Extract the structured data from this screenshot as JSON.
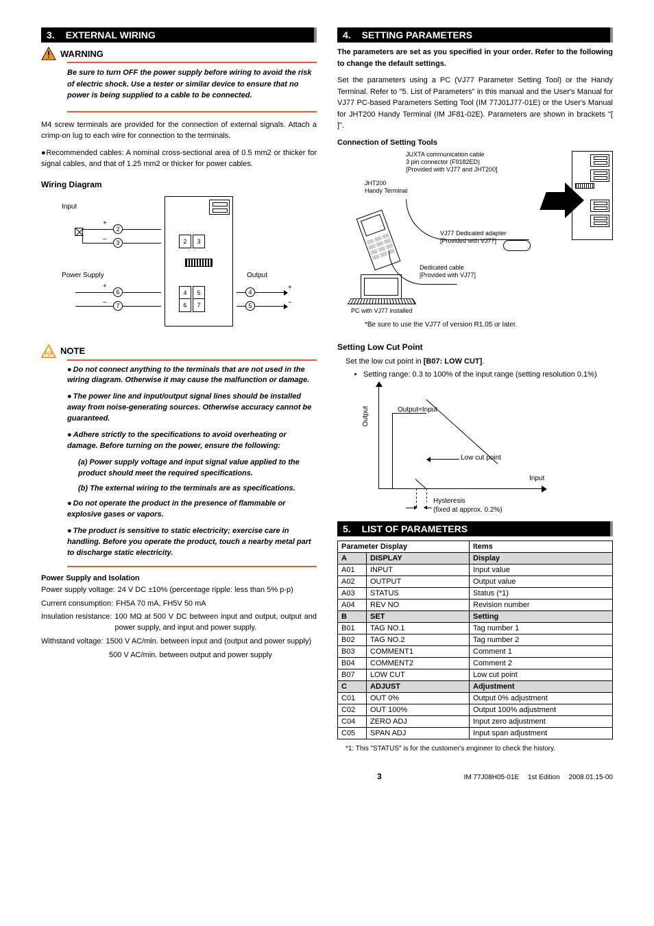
{
  "left": {
    "sec3": {
      "num": "3.",
      "title": "EXTERNAL WIRING"
    },
    "warning_title": "WARNING",
    "warning_body": "Be sure to turn OFF the power supply before wiring to avoid the risk of electric shock. Use a tester or similar device to ensure that no power is being supplied to a cable to be connected.",
    "m4_para": "M4 screw terminals are provided for the connection of external signals. Attach a crimp-on lug to each wire for connection to the terminals.",
    "cables_para": "●Recommended cables: A nominal cross-sectional area of 0.5 mm2 or thicker for signal cables, and that of 1.25 mm2 or thicker for power cables.",
    "wiring_heading": "Wiring Diagram",
    "wd": {
      "input": "Input",
      "power": "Power Supply",
      "output": "Output",
      "plus": "+",
      "minus": "−",
      "t2": "2",
      "t3": "3",
      "t4": "4",
      "t5": "5",
      "t6": "6",
      "t7": "7"
    },
    "note_title": "NOTE",
    "notes": [
      "Do not connect anything to the terminals that are not used in the wiring diagram. Otherwise it may cause the malfunction or damage.",
      "The power line and input/output signal lines should be installed away from noise-generating sources. Otherwise accuracy cannot be guaranteed.",
      "Adhere strictly to the specifications to avoid overheating or damage. Before turning on the power, ensure the following:"
    ],
    "note_sub_a": "(a) Power supply voltage and input signal value applied to the product should meet the required specifications.",
    "note_sub_b": "(b) The external wiring to the terminals are as specifications.",
    "notes2": [
      "Do not operate the product in the presence of flammable or explosive gases or vapors.",
      "The product is sensitive to static electricity; exercise care in handling. Before you operate the product, touch a nearby metal part to discharge static electricity."
    ],
    "psi_heading": "Power Supply and Isolation",
    "psi_voltage_l": "Power supply voltage:",
    "psi_voltage_v": "24 V DC ±10% (percentage ripple: less than 5% p-p)",
    "psi_current_l": "Current consumption:",
    "psi_current_v": "FH5A 70 mA, FH5V 50 mA",
    "psi_insul_l": "Insulation resistance:",
    "psi_insul_v": "100 MΩ at 500 V DC between input and output, output and power supply, and input and power supply.",
    "psi_with_l": "Withstand voltage:",
    "psi_with_v": "1500 V AC/min. between input and (output and power supply)",
    "psi_with_v2": "500 V AC/min. between output and power supply"
  },
  "right": {
    "sec4": {
      "num": "4.",
      "title": "SETTING PARAMETERS"
    },
    "sp_bold": "The parameters are set as you specified in your order. Refer to the following to change the default settings.",
    "sp_para": "Set the parameters using a PC (VJ77 Parameter Setting Tool) or the Handy Terminal. Refer to \"5. List of Parameters\" in this manual and the User's Manual for VJ77 PC-based Parameters Setting Tool (IM 77J01J77-01E) or the User's Manual for JHT200 Handy Terminal (IM JF81-02E). Parameters are shown in brackets \"[ ]\".",
    "conn_heading": "Connection of Setting Tools",
    "td": {
      "juxta1": "JUXTA communication cable",
      "juxta2": "3 pin connector (F9182ED)",
      "juxta3": "[Provided with VJ77 and JHT200]",
      "jht": "JHT200",
      "handy": "Handy Terminal",
      "adapter1": "VJ77 Dedicated adapter",
      "adapter2": "[Provided with VJ77]",
      "ded1": "Dedicated cable",
      "ded2": "[Provided with VJ77]",
      "pc": "PC with VJ77 installed",
      "note": "*Be sure to use the VJ77 of version R1.05 or later."
    },
    "lowcut_heading": "Setting Low Cut Point",
    "lowcut_set": "Set the low cut point in ",
    "lowcut_param": "[B07: LOW CUT]",
    "lowcut_bullet": "Setting range: 0.3 to 100% of the input range (setting resolution 0.1%)",
    "graph": {
      "output": "Output",
      "outin": "Output=Input",
      "low": "Low cut point",
      "input": "Input",
      "hys": "Hysteresis",
      "fixed": "(fixed at approx. 0.2%)"
    },
    "sec5": {
      "num": "5.",
      "title": "LIST OF PARAMETERS"
    },
    "table": {
      "h1": "Parameter Display",
      "h2": "Items",
      "groups": [
        {
          "code": "A",
          "disp": "DISPLAY",
          "item": "Display",
          "rows": [
            {
              "c": "A01",
              "d": "INPUT",
              "i": "Input value"
            },
            {
              "c": "A02",
              "d": "OUTPUT",
              "i": "Output value"
            },
            {
              "c": "A03",
              "d": "STATUS",
              "i": "Status (*1)"
            },
            {
              "c": "A04",
              "d": "REV NO",
              "i": "Revision number"
            }
          ]
        },
        {
          "code": "B",
          "disp": "SET",
          "item": "Setting",
          "rows": [
            {
              "c": "B01",
              "d": "TAG NO.1",
              "i": "Tag number 1"
            },
            {
              "c": "B02",
              "d": "TAG NO.2",
              "i": "Tag number 2"
            },
            {
              "c": "B03",
              "d": "COMMENT1",
              "i": "Comment 1"
            },
            {
              "c": "B04",
              "d": "COMMENT2",
              "i": "Comment 2"
            },
            {
              "c": "B07",
              "d": "LOW CUT",
              "i": "Low cut point"
            }
          ]
        },
        {
          "code": "C",
          "disp": "ADJUST",
          "item": "Adjustment",
          "rows": [
            {
              "c": "C01",
              "d": "OUT 0%",
              "i": "Output 0% adjustment"
            },
            {
              "c": "C02",
              "d": "OUT 100%",
              "i": "Output 100% adjustment"
            },
            {
              "c": "C04",
              "d": "ZERO ADJ",
              "i": "Input zero adjustment"
            },
            {
              "c": "C05",
              "d": "SPAN ADJ",
              "i": "Input span adjustment"
            }
          ]
        }
      ]
    },
    "footnote": "*1: This \"STATUS\" is for the customer's engineer to check the history."
  },
  "footer": {
    "page": "3",
    "doc": "IM 77J08H05-01E",
    "ed": "1st Edition",
    "date": "2008.01.15-00"
  }
}
